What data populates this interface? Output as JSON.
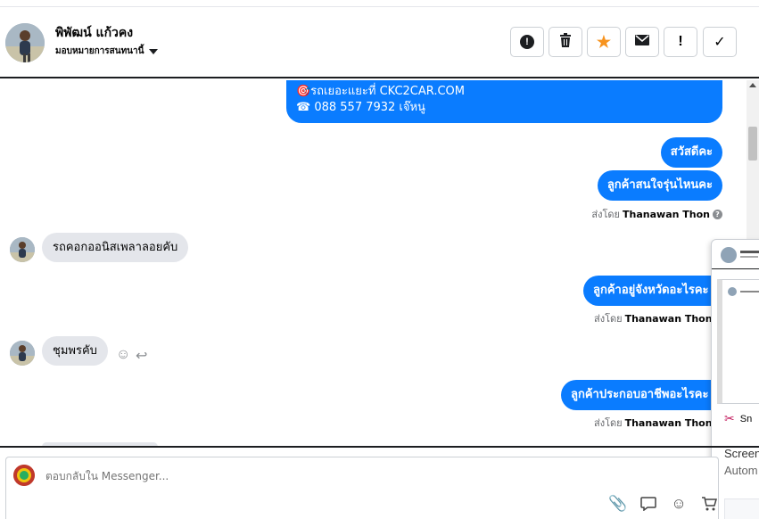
{
  "header": {
    "name": "พิพัฒน์ แก้วคง",
    "assign_label": "มอบหมายการสนทนานี้",
    "actions": [
      {
        "id": "report",
        "glyph": "!"
      },
      {
        "id": "delete",
        "glyph": "🗑"
      },
      {
        "id": "star",
        "glyph": "★"
      },
      {
        "id": "mail",
        "glyph": "✉"
      },
      {
        "id": "important",
        "glyph": "!"
      },
      {
        "id": "done",
        "glyph": "✓"
      }
    ]
  },
  "messages": {
    "promo_line1": "🎯รถเยอะแยะที่ CKC2CAR.COM",
    "promo_line2": "☎ 088 557 7932 เจ๊หนู",
    "out1": "สวัสดีคะ",
    "out2": "ลูกค้าสนใจรุ่นไหนคะ",
    "sent_prefix": "ส่งโดย",
    "agent": "Thanawan Thon",
    "in1": "รถคอกออนิสเพลาลอยคับ",
    "out3": "ลูกค้าอยู่จังหวัดอะไรคะ",
    "in2": "ชุมพรคับ",
    "out4": "ลูกค้าประกอบอาชีพอะไรคะ"
  },
  "popup": {
    "snip": "Sn",
    "line1": "Screen",
    "line2": "Autom"
  },
  "reply": {
    "placeholder": "ตอบกลับใน Messenger..."
  },
  "colors": {
    "accent": "#0a7cff",
    "incoming": "#e4e6eb",
    "star": "#f7931e"
  },
  "icons": [
    "report-icon",
    "trash-icon",
    "star-icon",
    "mail-icon",
    "exclamation-icon",
    "check-icon",
    "attach-icon",
    "comment-icon",
    "emoji-icon",
    "cart-icon"
  ]
}
